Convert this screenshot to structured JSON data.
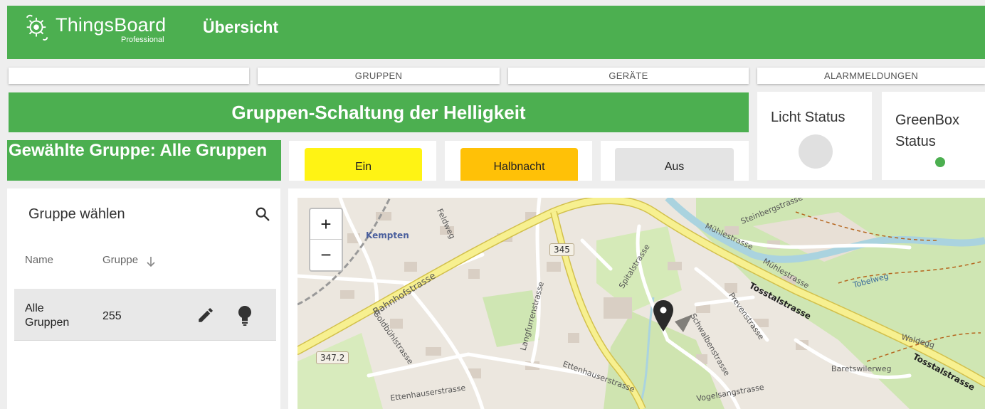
{
  "header": {
    "brand": "ThingsBoard",
    "brand_sub": "Professional",
    "title": "Übersicht"
  },
  "tabs": [
    {
      "label": ""
    },
    {
      "label": "GRUPPEN"
    },
    {
      "label": "GERÄTE"
    },
    {
      "label": "ALARMMELDUNGEN"
    }
  ],
  "heading": "Gruppen-Schaltung der Helligkeit",
  "selected_group": "Gewählte Gruppe: Alle Gruppen",
  "actions": {
    "on": "Ein",
    "half": "Halbnacht",
    "off": "Aus"
  },
  "status": {
    "light_label": "Licht Status",
    "greenbox_label": "GreenBox Status",
    "greenbox_color": "#4caf50",
    "light_color": "#e0e0e0"
  },
  "groups_panel": {
    "title": "Gruppe wählen",
    "columns": [
      "Name",
      "Gruppe"
    ],
    "rows": [
      {
        "name": "Alle Gruppen",
        "group": "255"
      }
    ]
  },
  "map": {
    "zoom_in": "+",
    "zoom_out": "−",
    "labels": {
      "kempten": "Kempten",
      "feldweg": "Feldweg",
      "bahnhofstrasse": "Bahnhofstrasse",
      "r345": "345",
      "r347": "347.2",
      "spitalstrasse": "Spitalstrasse",
      "muehlestrasse": "Mühlestrasse",
      "muehlestrasse2": "Mühlestrasse",
      "steinbergstrasse": "Steinbergstrasse",
      "tobelweg": "Tobelweg",
      "tosstalstrasse": "Tosstalstrasse",
      "tosstalstrasse2": "Tosstalstrasse",
      "prevenstrasse": "Prevenstrasse",
      "schwalbenstrasse": "Schwalbenstrasse",
      "langfurrenstrasse": "Langfurrenstrasse",
      "goldbuehlstrasse": "Goldbühlstrasse",
      "ettenhauserstrasse": "Ettenhauserstrasse",
      "ettenhauserstrasse2": "Ettenhauserstrasse",
      "vogelsangstrasse": "Vogelsangstrasse",
      "baretswilerweg": "Baretswilerweg",
      "waldegg": "Waldegg"
    }
  }
}
